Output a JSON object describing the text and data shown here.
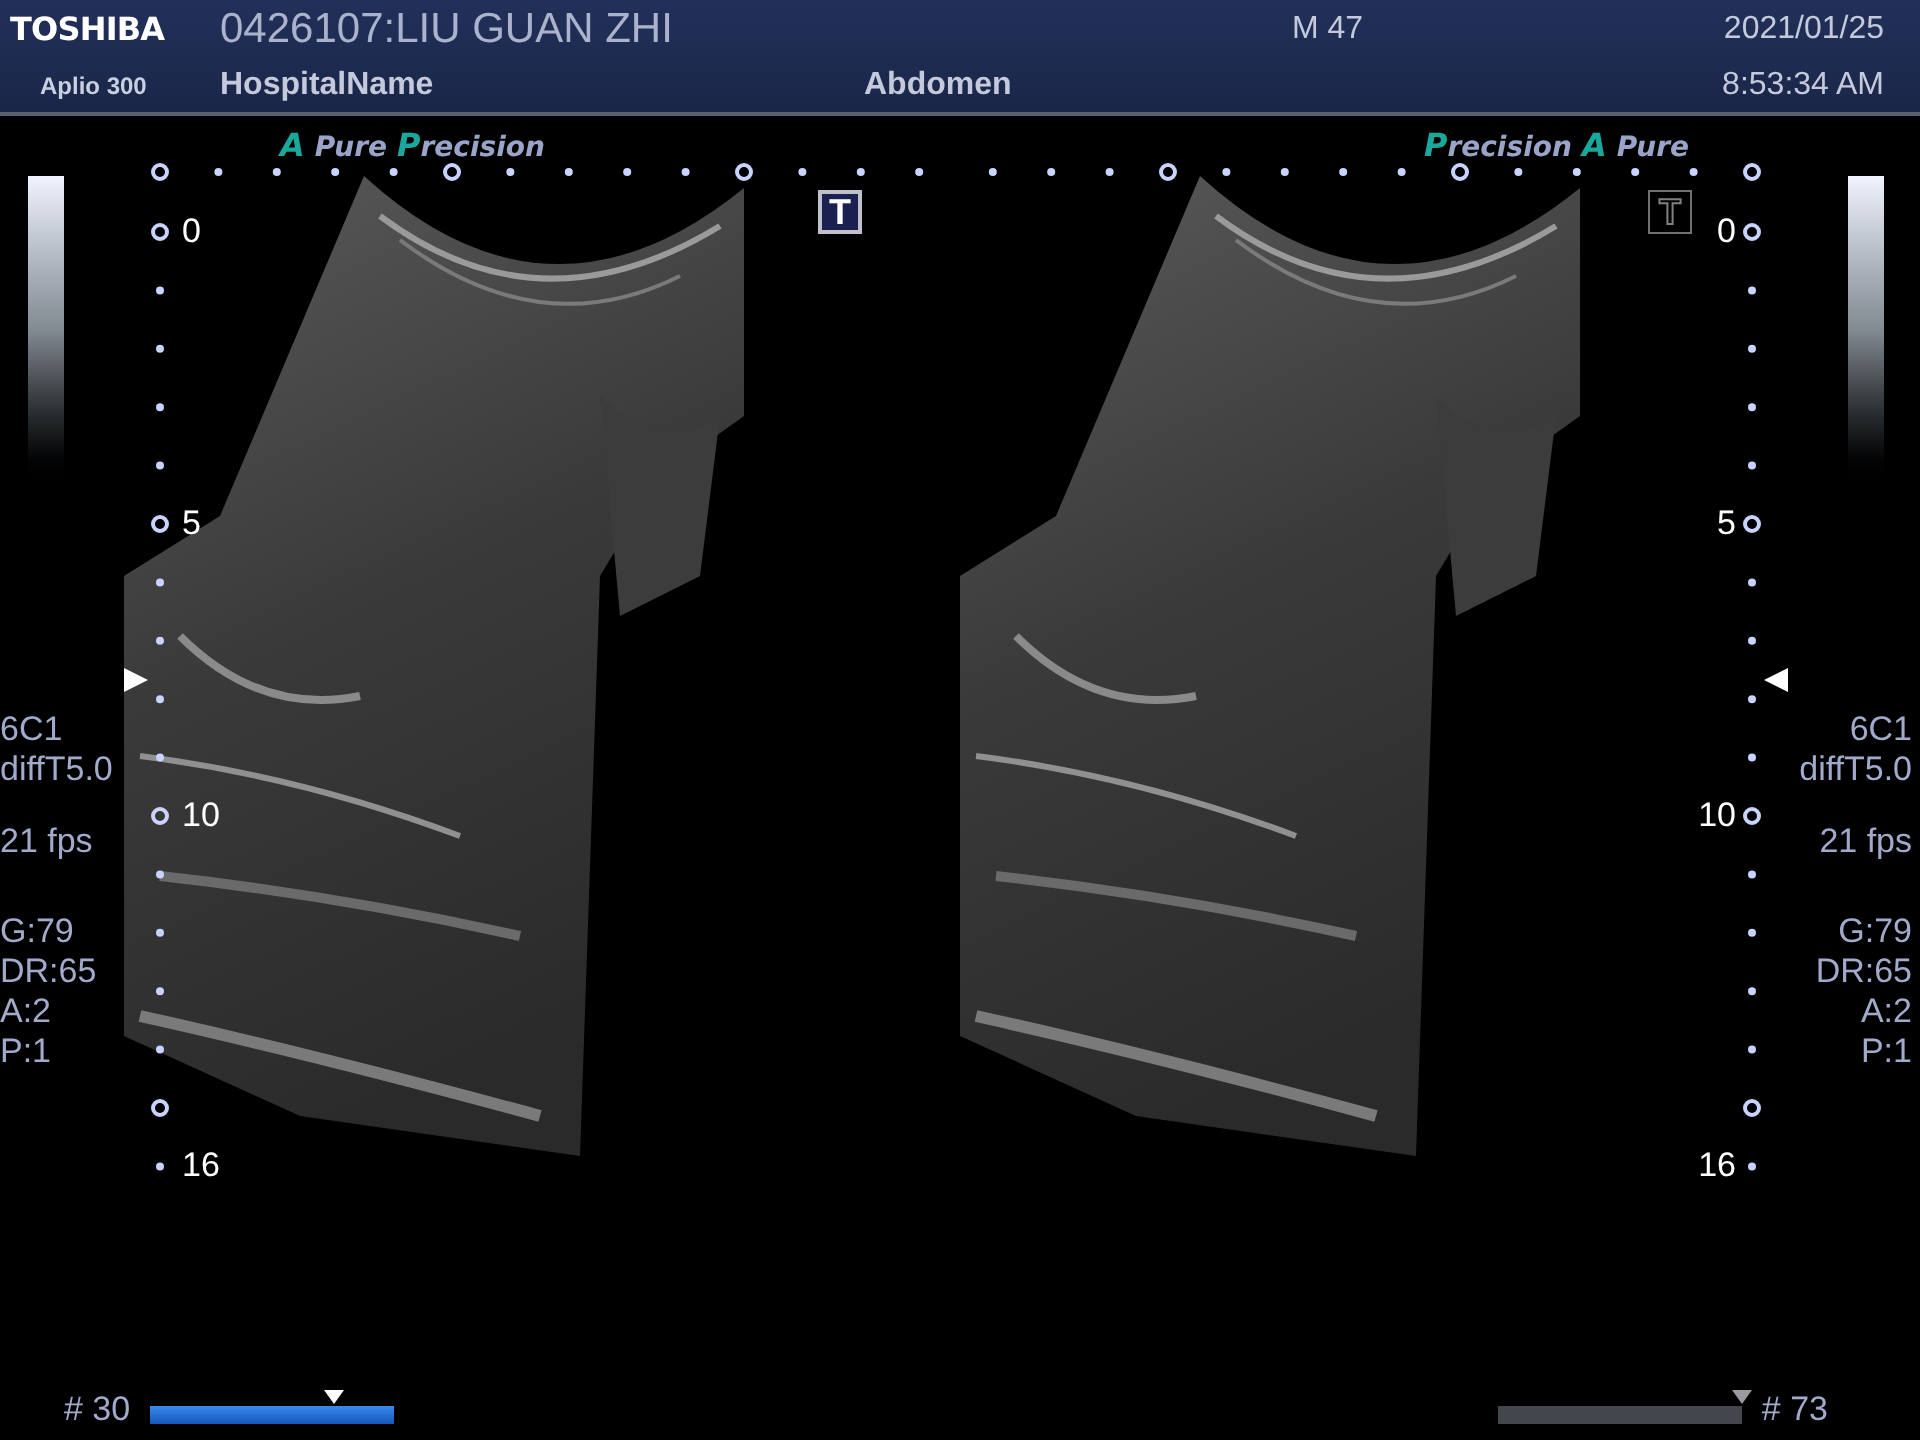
{
  "header": {
    "brand": "TOSHIBA",
    "model": "Aplio 300",
    "patient": "0426107:LIU GUAN ZHI",
    "hospital": "HospitalName",
    "sex_age": "M 47",
    "exam": "Abdomen",
    "date": "2021/01/25",
    "time": "8:53:34 AM"
  },
  "panels": [
    {
      "kind": "left",
      "logo": [
        {
          "text": "A",
          "accent": true
        },
        {
          "text": "Pure",
          "accent": false
        },
        {
          "text": "P",
          "accent": true
        },
        {
          "text": "recision",
          "accent": false
        }
      ],
      "t_button": {
        "label": "T",
        "selected": true
      },
      "depth_labels": [
        "0",
        "5",
        "10",
        "16"
      ],
      "param_groups": [
        {
          "lines": [
            "6C1",
            "diffT5.0"
          ]
        },
        {
          "lines": [
            "21 fps"
          ]
        },
        {
          "lines": [
            "G:79",
            "DR:65",
            "A:2",
            "P:1"
          ]
        }
      ],
      "frame": "# 30",
      "cine": {
        "selected": true,
        "level": 0.75
      }
    },
    {
      "kind": "right",
      "logo": [
        {
          "text": "P",
          "accent": true
        },
        {
          "text": "recision",
          "accent": false
        },
        {
          "text": "A",
          "accent": true
        },
        {
          "text": "Pure",
          "accent": false
        }
      ],
      "t_button": {
        "label": "T",
        "selected": false
      },
      "depth_labels": [
        "0",
        "5",
        "10",
        "16"
      ],
      "param_groups": [
        {
          "lines": [
            "6C1",
            "diffT5.0"
          ]
        },
        {
          "lines": [
            "21 fps"
          ]
        },
        {
          "lines": [
            "G:79",
            "DR:65",
            "A:2",
            "P:1"
          ]
        }
      ],
      "frame": "# 73",
      "cine": {
        "selected": false,
        "level": 1.0
      }
    }
  ]
}
